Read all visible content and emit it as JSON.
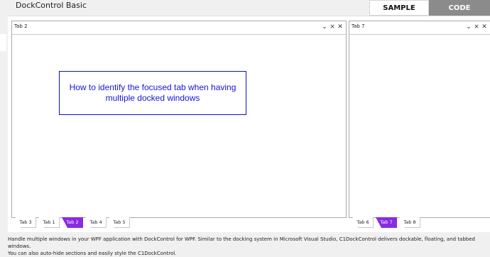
{
  "app_title": "DockControl Basic",
  "view_toggle": {
    "sample_label": "SAMPLE",
    "code_label": "CODE"
  },
  "left_panel": {
    "title": "Tab 2",
    "message": "How to identify the focused tab when having multiple docked windows",
    "tabs": [
      {
        "label": "Tab 3",
        "active": false
      },
      {
        "label": "Tab 1",
        "active": false
      },
      {
        "label": "Tab 2",
        "active": true
      },
      {
        "label": "Tab 4",
        "active": false
      },
      {
        "label": "Tab 5",
        "active": false
      }
    ]
  },
  "right_panel": {
    "title": "Tab 7",
    "tabs": [
      {
        "label": "Tab 6",
        "active": false
      },
      {
        "label": "Tab 7",
        "active": true
      },
      {
        "label": "Tab 8",
        "active": false
      }
    ]
  },
  "panel_controls": {
    "dropdown_icon": "chevron-down",
    "unpin_icon": "pin-off",
    "close_icon": "close"
  },
  "accent_color": "#8a2be2",
  "description_line1": "Handle multiple windows in your WPF application with DockControl for WPF. Similar to the docking system in Microsoft Visual Studio, C1DockControl delivers dockable, floating, and tabbed windows.",
  "description_line2": "You can also auto-hide sections and easily style the C1DockControl."
}
